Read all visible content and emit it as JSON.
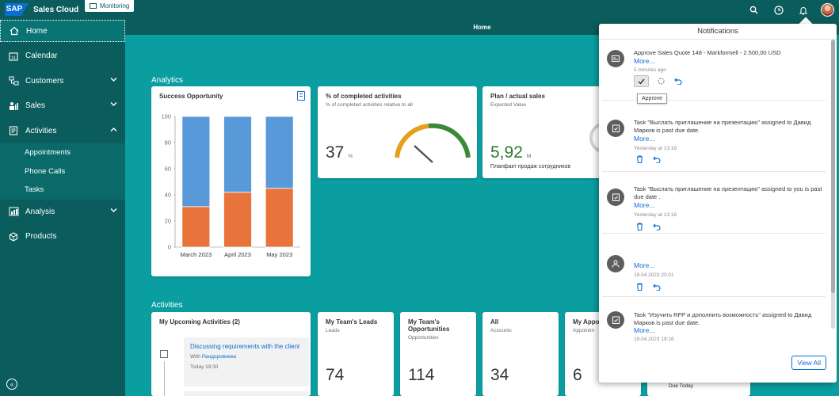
{
  "shell": {
    "logo": "SAP",
    "app_title": "Sales Cloud",
    "monitoring_tab": "Monitoring",
    "icons": [
      "search-icon",
      "clock-icon",
      "bell-icon",
      "avatar"
    ]
  },
  "sidenav": {
    "items": [
      {
        "label": "Home",
        "icon": "home-icon"
      },
      {
        "label": "Calendar",
        "icon": "calendar-icon"
      },
      {
        "label": "Customers",
        "icon": "customers-icon"
      },
      {
        "label": "Sales",
        "icon": "sales-icon"
      },
      {
        "label": "Activities",
        "icon": "activities-icon"
      },
      {
        "label": "Analysis",
        "icon": "analysis-icon"
      },
      {
        "label": "Products",
        "icon": "products-icon"
      }
    ],
    "activities_sub": [
      "Appointments",
      "Phone Calls",
      "Tasks"
    ]
  },
  "page": {
    "title": "Home"
  },
  "analytics": {
    "section": "Analytics",
    "success": {
      "title": "Success Opportunity"
    },
    "completed": {
      "title": "% of completed activities",
      "subtitle": "% of completed activities relative to all",
      "value": "37",
      "unit": "%"
    },
    "plan": {
      "title": "Plan / actual sales",
      "subtitle": "Expected Value",
      "value": "5,92",
      "unit": "M",
      "caption": "Планфакт продаж сотрудников"
    }
  },
  "chart_data": {
    "type": "bar",
    "stacked": true,
    "categories": [
      "March 2023",
      "April 2023",
      "May 2023"
    ],
    "series": [
      {
        "values": [
          31,
          42,
          45
        ],
        "color": "#e8743b"
      },
      {
        "values": [
          69,
          58,
          55
        ],
        "color": "#5899da"
      }
    ],
    "ylim": [
      0,
      100
    ],
    "yticks": [
      0,
      20,
      40,
      60,
      80,
      100
    ],
    "grid": false
  },
  "activities": {
    "section": "Activities",
    "upcoming": {
      "title": "My Upcoming Activities (2)",
      "item_title": "Discussing requirements with the client",
      "item_with_label": "With",
      "item_with_value": "Рандоровника",
      "item_time": "Today 19:30"
    },
    "leads": {
      "title": "My Team's Leads",
      "subtitle": "Leads",
      "value": "74"
    },
    "opps": {
      "title": "My Team's Opportunities",
      "subtitle": "Opportunities",
      "value": "114"
    },
    "all": {
      "title": "All",
      "subtitle": "Accounts",
      "value": "34"
    },
    "appointments": {
      "title": "My Appo",
      "subtitle": "Appointm",
      "value": "6"
    },
    "due_today": "Due Today"
  },
  "notifications": {
    "header": "Notifications",
    "tooltip": "Approve",
    "view_all": "View All",
    "more": "More...",
    "items": [
      {
        "text": "Approve Sales Quote 148 - Markformell - 2.500,00 USD",
        "time": "5 minutes ago",
        "icon": "quote-icon"
      },
      {
        "text": "Task \"Выслать приглашение на презентацию\" assigned to Давид Марков is past due date.",
        "time": "Yesterday at 13:18",
        "icon": "task-icon"
      },
      {
        "text": "Task \"Выслать приглашение на презентацию\" assigned to you is past due date .",
        "time": "Yesterday at 13:18",
        "icon": "task-icon"
      },
      {
        "text": "",
        "time": "18.04.2023 20:01",
        "icon": "person-icon"
      },
      {
        "text": "Task \"Изучить RFP и дополнить возможность\" assigned to Давид Марков is past due date.",
        "time": "18.04.2023 19:16",
        "icon": "task-icon"
      }
    ]
  }
}
